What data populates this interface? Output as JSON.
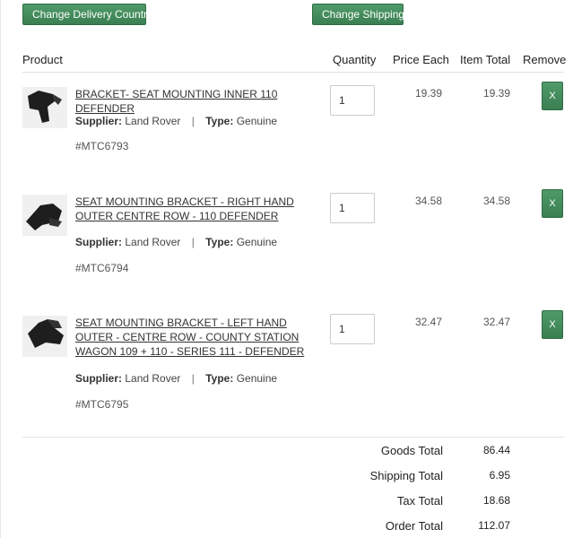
{
  "actions": {
    "change_country": "Change Delivery Country",
    "change_shipping": "Change Shipping"
  },
  "columns": {
    "product": "Product",
    "quantity": "Quantity",
    "price_each": "Price Each",
    "item_total": "Item Total",
    "remove": "Remove"
  },
  "labels": {
    "supplier": "Supplier:",
    "type": "Type:",
    "separator": "|",
    "remove_button": "X"
  },
  "items": [
    {
      "name": "BRACKET- SEAT MOUNTING INNER 110 DEFENDER",
      "supplier": "Land Rover",
      "type": "Genuine",
      "sku": "#MTC6793",
      "quantity": "1",
      "price_each": "19.39",
      "item_total": "19.39"
    },
    {
      "name": "SEAT MOUNTING BRACKET - RIGHT HAND OUTER CENTRE ROW - 110 DEFENDER",
      "supplier": "Land Rover",
      "type": "Genuine",
      "sku": "#MTC6794",
      "quantity": "1",
      "price_each": "34.58",
      "item_total": "34.58"
    },
    {
      "name": "SEAT MOUNTING BRACKET - LEFT HAND OUTER - CENTRE ROW - COUNTY STATION WAGON 109 + 110 - SERIES 111 - DEFENDER",
      "supplier": "Land Rover",
      "type": "Genuine",
      "sku": "#MTC6795",
      "quantity": "1",
      "price_each": "32.47",
      "item_total": "32.47"
    }
  ],
  "summary": {
    "goods_total_label": "Goods Total",
    "goods_total": "86.44",
    "shipping_total_label": "Shipping Total",
    "shipping_total": "6.95",
    "tax_total_label": "Tax Total",
    "tax_total": "18.68",
    "order_total_label": "Order Total",
    "order_total": "112.07"
  },
  "colors": {
    "button_green": "#3a7f52",
    "text": "#333333"
  }
}
